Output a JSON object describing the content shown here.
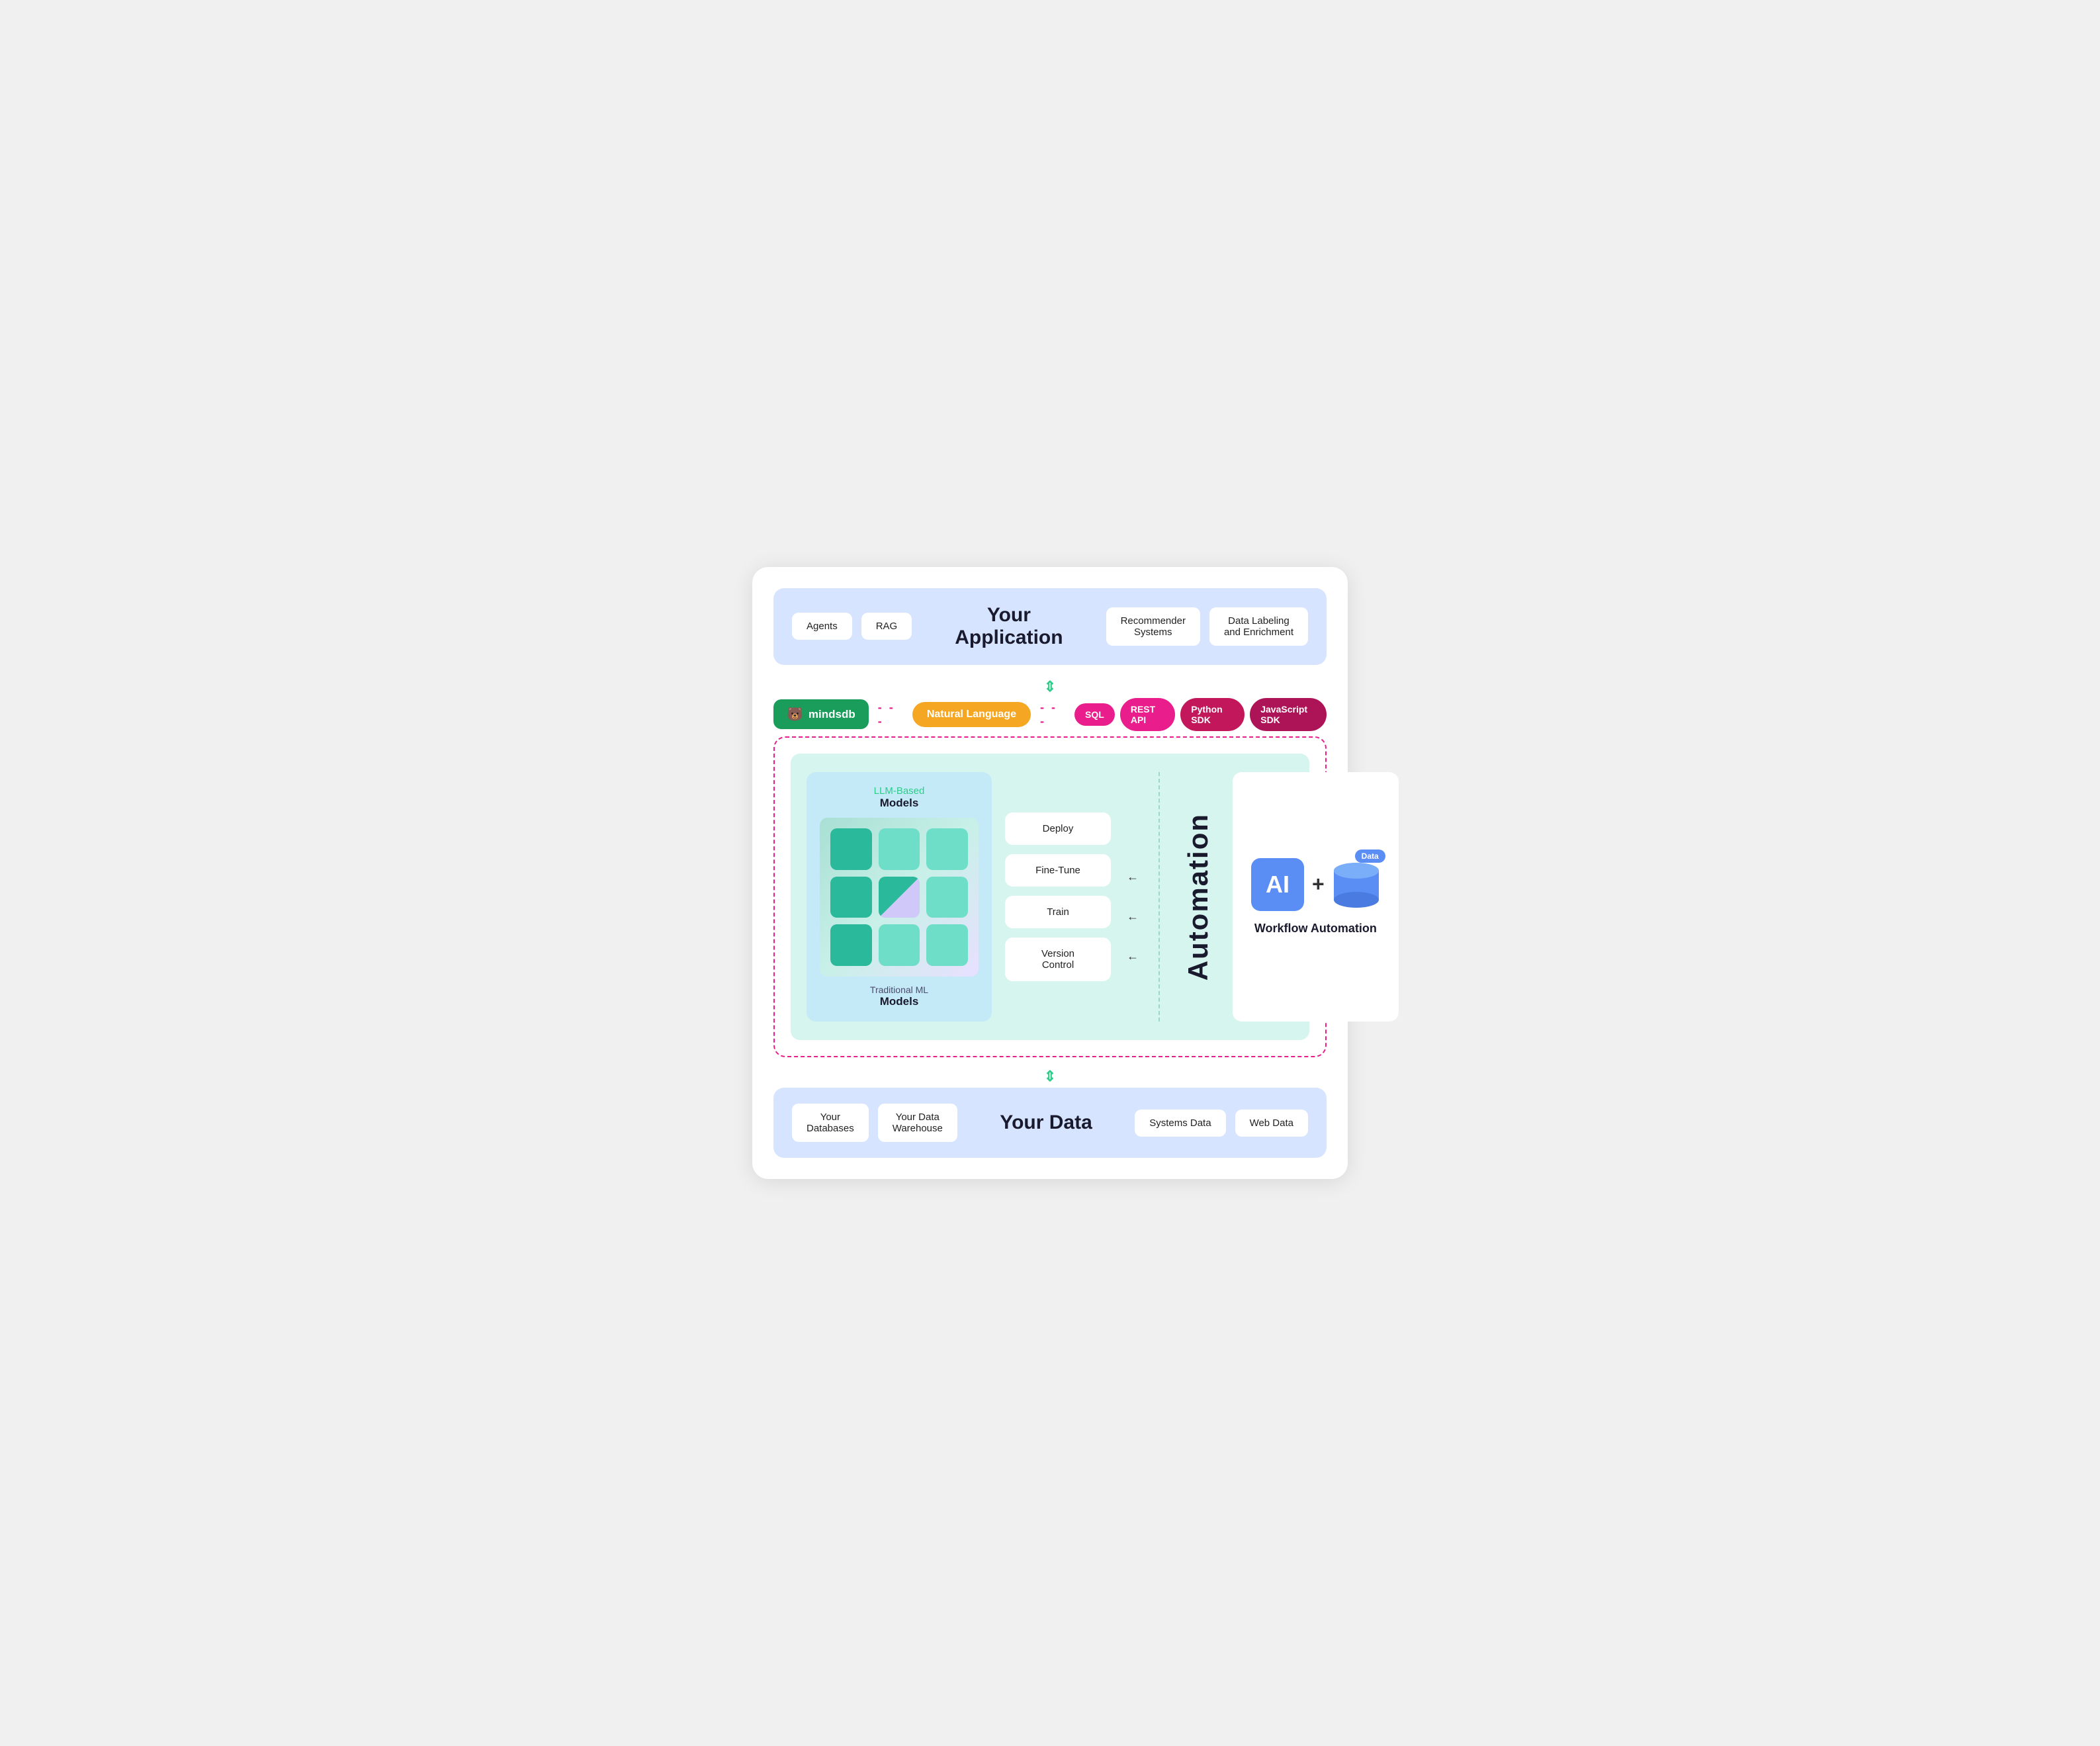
{
  "diagram": {
    "top_section": {
      "title": "Your\nApplication",
      "left_items": [
        {
          "label": "Agents"
        },
        {
          "label": "RAG"
        }
      ],
      "right_items": [
        {
          "label": "Recommender\nSystems"
        },
        {
          "label": "Data Labeling\nand Enrichment"
        }
      ]
    },
    "mindsdb_row": {
      "mindsdb_label": "mindsdb",
      "natural_language": "Natural Language",
      "arrow": "⇕",
      "sdk_items": [
        {
          "label": "SQL"
        },
        {
          "label": "REST API"
        },
        {
          "label": "Python SDK"
        },
        {
          "label": "JavaScript SDK"
        }
      ]
    },
    "inner": {
      "models_section": {
        "llm_label": "LLM-Based",
        "llm_bold": "Models",
        "trad_label": "Traditional ML",
        "trad_bold": "Models"
      },
      "operations": [
        {
          "label": "Deploy"
        },
        {
          "label": "Fine-Tune"
        },
        {
          "label": "Train"
        },
        {
          "label": "Version\nControl"
        }
      ],
      "automation_label": "Automation",
      "workflow": {
        "ai_label": "AI",
        "data_label": "Data",
        "plus": "+",
        "title": "Workflow Automation"
      }
    },
    "bottom_section": {
      "title": "Your Data",
      "left_items": [
        {
          "label": "Your\nDatabases"
        },
        {
          "label": "Your Data\nWarehouse"
        }
      ],
      "right_items": [
        {
          "label": "Systems Data"
        },
        {
          "label": "Web Data"
        }
      ]
    },
    "arrows": {
      "top_arrow": "⇕",
      "bottom_arrow": "⇕",
      "left_arrows": [
        "←",
        "←",
        "←"
      ]
    }
  }
}
